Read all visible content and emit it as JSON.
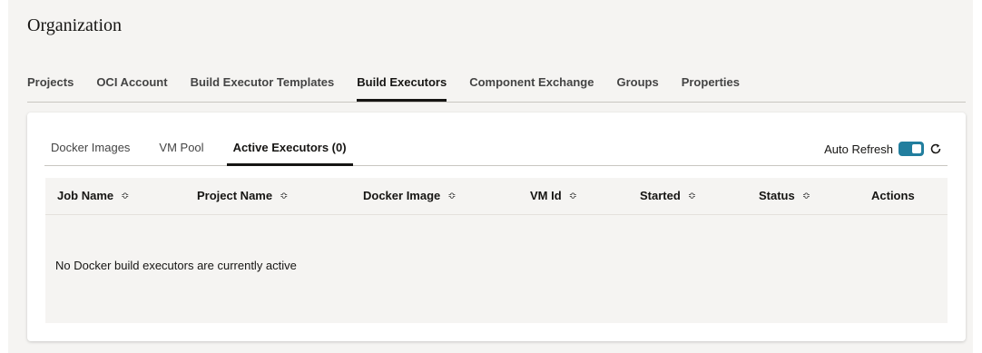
{
  "page": {
    "title": "Organization"
  },
  "main_tabs": [
    {
      "label": "Projects",
      "active": false
    },
    {
      "label": "OCI Account",
      "active": false
    },
    {
      "label": "Build Executor Templates",
      "active": false
    },
    {
      "label": "Build Executors",
      "active": true
    },
    {
      "label": "Component Exchange",
      "active": false
    },
    {
      "label": "Groups",
      "active": false
    },
    {
      "label": "Properties",
      "active": false
    }
  ],
  "sub_tabs": [
    {
      "label": "Docker Images",
      "active": false
    },
    {
      "label": "VM Pool",
      "active": false
    },
    {
      "label": "Active Executors (0)",
      "active": true
    }
  ],
  "auto_refresh": {
    "label": "Auto Refresh",
    "enabled": true,
    "accent": "#227e9e"
  },
  "table": {
    "columns": [
      "Job Name",
      "Project Name",
      "Docker Image",
      "VM Id",
      "Started",
      "Status",
      "Actions"
    ],
    "sortable": [
      true,
      true,
      true,
      true,
      true,
      true,
      false
    ],
    "empty_message": "No Docker build executors are currently active"
  },
  "icons": {
    "sort": "sort-icon",
    "refresh": "refresh-icon"
  }
}
